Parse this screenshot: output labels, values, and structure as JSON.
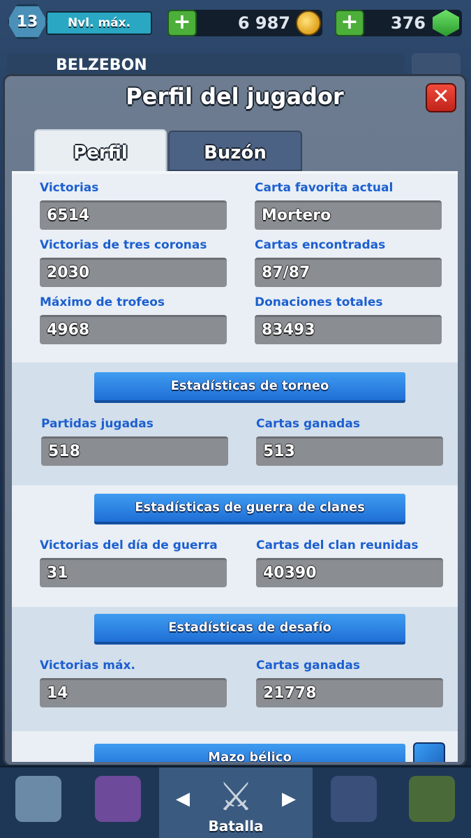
{
  "hud": {
    "level": "13",
    "level_status": "Nvl. máx.",
    "gold": "6 987",
    "gems": "376",
    "plus": "+",
    "player_name": "BELZEBON"
  },
  "modal": {
    "title": "Perfil del jugador",
    "close": "✕",
    "tabs": [
      "Perfil",
      "Buzón"
    ]
  },
  "stats": {
    "left": [
      {
        "label": "Victorias",
        "value": "6514"
      },
      {
        "label": "Victorias de tres coronas",
        "value": "2030"
      },
      {
        "label": "Máximo de trofeos",
        "value": "4968"
      }
    ],
    "right": [
      {
        "label": "Carta favorita actual",
        "value": "Mortero"
      },
      {
        "label": "Cartas encontradas",
        "value": "87/87"
      },
      {
        "label": "Donaciones totales",
        "value": "83493"
      }
    ]
  },
  "tournament": {
    "title": "Estadísticas de torneo",
    "fields": [
      {
        "label": "Partidas jugadas",
        "value": "518"
      },
      {
        "label": "Cartas ganadas",
        "value": "513"
      }
    ]
  },
  "clan_war": {
    "title": "Estadísticas de guerra de clanes",
    "fields": [
      {
        "label": "Victorias del día de guerra",
        "value": "31"
      },
      {
        "label": "Cartas del clan reunidas",
        "value": "40390"
      }
    ]
  },
  "challenge": {
    "title": "Estadísticas de desafío",
    "fields": [
      {
        "label": "Victorias máx.",
        "value": "14"
      },
      {
        "label": "Cartas ganadas",
        "value": "21778"
      }
    ]
  },
  "war_deck": {
    "title": "Mazo bélico"
  },
  "bottom_nav": {
    "battle_label": "Batalla",
    "arrow_left": "◀",
    "arrow_right": "▶"
  },
  "colors": {
    "label_blue": "#1c5fd0",
    "banner_blue": "#2f86e6",
    "value_box": "#8a8d92"
  }
}
